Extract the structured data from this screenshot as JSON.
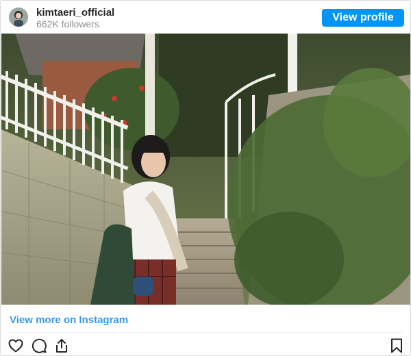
{
  "post": {
    "username": "kimtaeri_official",
    "followers": "662K followers",
    "view_profile_label": "View profile",
    "view_more_label": "View more on Instagram",
    "photo_alt": "",
    "icons": {
      "like": "heart-icon",
      "comment": "comment-icon",
      "share": "share-icon",
      "save": "bookmark-icon"
    },
    "colors": {
      "accent": "#0095f6",
      "link": "#3897f0",
      "muted": "#8e8e8e",
      "text": "#262626"
    }
  }
}
